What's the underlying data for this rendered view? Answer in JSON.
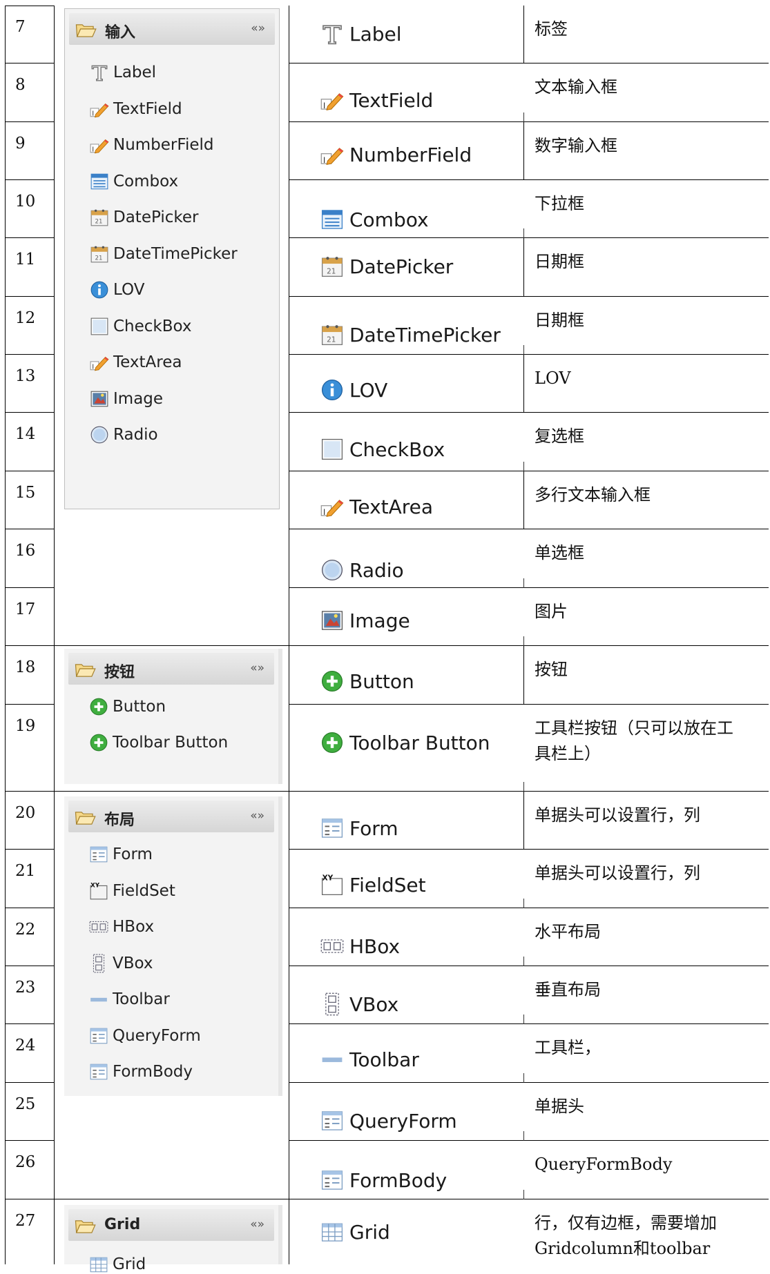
{
  "rows": [
    {
      "num": "7",
      "component": "Label",
      "desc": [
        "标签"
      ]
    },
    {
      "num": "8",
      "component": "TextField",
      "desc": [
        "文本输入框"
      ]
    },
    {
      "num": "9",
      "component": "NumberField",
      "desc": [
        "数字输入框"
      ]
    },
    {
      "num": "10",
      "component": "Combox",
      "desc": [
        "下拉框"
      ]
    },
    {
      "num": "11",
      "component": "DatePicker",
      "desc": [
        "日期框"
      ]
    },
    {
      "num": "12",
      "component": "DateTimePicker",
      "desc": [
        "日期框"
      ]
    },
    {
      "num": "13",
      "component": "LOV",
      "desc": [
        "LOV"
      ]
    },
    {
      "num": "14",
      "component": "CheckBox",
      "desc": [
        "复选框"
      ]
    },
    {
      "num": "15",
      "component": "TextArea",
      "desc": [
        "多行文本输入框"
      ]
    },
    {
      "num": "16",
      "component": "Radio",
      "desc": [
        "单选框"
      ]
    },
    {
      "num": "17",
      "component": "Image",
      "desc": [
        "图片"
      ]
    },
    {
      "num": "18",
      "component": "Button",
      "desc": [
        "按钮"
      ]
    },
    {
      "num": "19",
      "component": "Toolbar Button",
      "desc": [
        "工具栏按钮（只可以放在工",
        "具栏上）"
      ]
    },
    {
      "num": "20",
      "component": "Form",
      "desc": [
        "单据头可以设置行，列"
      ]
    },
    {
      "num": "21",
      "component": "FieldSet",
      "desc": [
        "单据头可以设置行，列"
      ]
    },
    {
      "num": "22",
      "component": "HBox",
      "desc": [
        "水平布局"
      ]
    },
    {
      "num": "23",
      "component": "VBox",
      "desc": [
        "垂直布局"
      ]
    },
    {
      "num": "24",
      "component": "Toolbar",
      "desc": [
        "工具栏，"
      ]
    },
    {
      "num": "25",
      "component": "QueryForm",
      "desc": [
        "单据头"
      ]
    },
    {
      "num": "26",
      "component": "FormBody",
      "desc": [
        "QueryFormBody"
      ]
    },
    {
      "num": "27",
      "component": "Grid",
      "desc": [
        "行，仅有边框，需要增加",
        "Gridcolumn和toolbar"
      ]
    }
  ],
  "palettes": {
    "input": {
      "title": "输入",
      "collapse": "«»",
      "items": [
        "Label",
        "TextField",
        "NumberField",
        "Combox",
        "DatePicker",
        "DateTimePicker",
        "LOV",
        "CheckBox",
        "TextArea",
        "Image",
        "Radio"
      ]
    },
    "button": {
      "title": "按钮",
      "collapse": "«»",
      "items": [
        "Button",
        "Toolbar Button"
      ]
    },
    "layout": {
      "title": "布局",
      "collapse": "«»",
      "items": [
        "Form",
        "FieldSet",
        "HBox",
        "VBox",
        "Toolbar",
        "QueryForm",
        "FormBody"
      ]
    },
    "grid": {
      "title": "Grid",
      "collapse": "«»",
      "items": [
        "Grid"
      ]
    }
  },
  "icons": {
    "Label": "text-t-icon",
    "TextField": "pencil-field-icon",
    "NumberField": "pencil-field-icon",
    "Combox": "combo-list-icon",
    "DatePicker": "calendar-icon",
    "DateTimePicker": "calendar-icon",
    "LOV": "info-icon",
    "CheckBox": "checkbox-icon",
    "TextArea": "pencil-field-icon",
    "Image": "picture-icon",
    "Radio": "radio-icon",
    "Button": "green-plus-icon",
    "Toolbar Button": "green-plus-icon",
    "Form": "form-icon",
    "FieldSet": "fieldset-icon",
    "HBox": "hbox-icon",
    "VBox": "vbox-icon",
    "Toolbar": "toolbar-bar-icon",
    "QueryForm": "form-icon",
    "FormBody": "form-icon",
    "Grid": "grid-table-icon",
    "folder": "folder-open-icon"
  },
  "colors": {
    "grid_line": "#000000",
    "palette_bg": "#f3f3f3",
    "palette_header": "#dcdcdc",
    "info_blue": "#3a8fd8",
    "plus_green": "#3fae3f",
    "pencil_orange": "#f0a030"
  }
}
